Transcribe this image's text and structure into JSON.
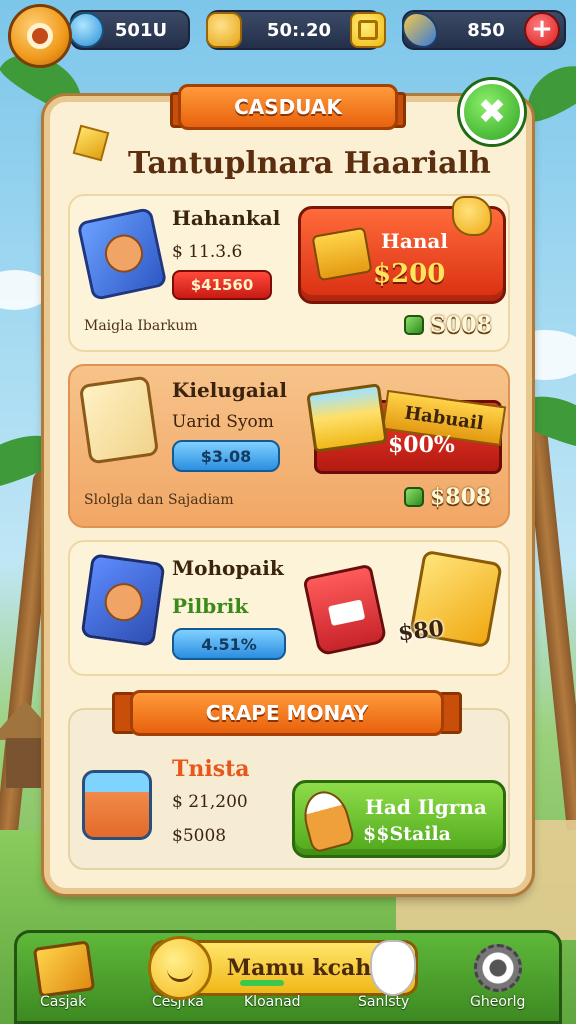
{
  "topbar": {
    "settings_icon": "settings-gear-icon",
    "resources": [
      {
        "icon": "blue-gem-icon",
        "value": "501U"
      },
      {
        "icon": "coin-stack-icon",
        "value": "50:.20"
      },
      {
        "icon": "gold-block-icon"
      },
      {
        "icon": "rocket-icon",
        "value": "850"
      }
    ],
    "add_button": "+"
  },
  "panel": {
    "banner": "CASDUAK",
    "title": "Tantuplnara Haarialh",
    "close_icon": "close-icon"
  },
  "cards": [
    {
      "name": "Hahankal",
      "price": "$ 11.3.6",
      "tag": "$41560",
      "note": "Maigla Ibarkum",
      "buy_label": "Hanal",
      "buy_price": "$200",
      "cost": "S008"
    },
    {
      "name": "Kielugaial",
      "subtitle": "Uarid Syom",
      "tag": "$3.08",
      "note": "Slolgla dan Sajadiam",
      "offer_ribbon": "Habuail",
      "offer_value": "$00%",
      "cost": "$808"
    },
    {
      "name": "Mohopaik",
      "subtitle": "Pilbrik",
      "tag": "4.51%",
      "card_price": "$80"
    }
  ],
  "section": {
    "banner": "CRAPE MONAY",
    "promo_name": "Tnista",
    "price1": "$ 21,200",
    "price2": "$5008",
    "buy_line1": "Had Ilgrna",
    "buy_line2": "$$Staila"
  },
  "nav": {
    "main_label": "Mamu kcah",
    "items": [
      "Casjak",
      "Cesjrka",
      "Kloanad",
      "Sanlsty",
      "Gheorlg"
    ]
  },
  "colors": {
    "accent_orange": "#e8620e",
    "buy_red": "#d92e12",
    "buy_green": "#4ea81a",
    "panel_bg": "#fbf0d4"
  }
}
